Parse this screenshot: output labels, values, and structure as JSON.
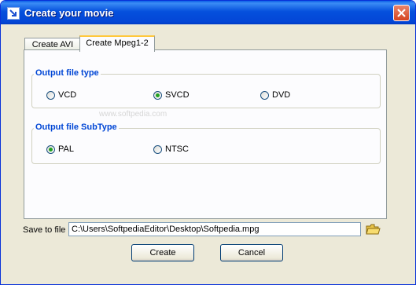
{
  "window": {
    "title": "Create your movie"
  },
  "tabs": [
    {
      "label": "Create AVI",
      "active": false
    },
    {
      "label": "Create Mpeg1-2",
      "active": true
    }
  ],
  "output_file_type": {
    "legend": "Output file type",
    "options": [
      {
        "label": "VCD",
        "selected": false
      },
      {
        "label": "SVCD",
        "selected": true
      },
      {
        "label": "DVD",
        "selected": false
      }
    ]
  },
  "output_file_subtype": {
    "legend": "Output file SubType",
    "options": [
      {
        "label": "PAL",
        "selected": true
      },
      {
        "label": "NTSC",
        "selected": false
      }
    ]
  },
  "save": {
    "label": "Save to file",
    "path": "C:\\Users\\SoftpediaEditor\\Desktop\\Softpedia.mpg"
  },
  "buttons": {
    "create": "Create",
    "cancel": "Cancel"
  },
  "watermark": "www.softpedia.com",
  "colors": {
    "legend": "#0046d5",
    "titlebar": "#0550dd",
    "radio_selected": "#21a121"
  }
}
